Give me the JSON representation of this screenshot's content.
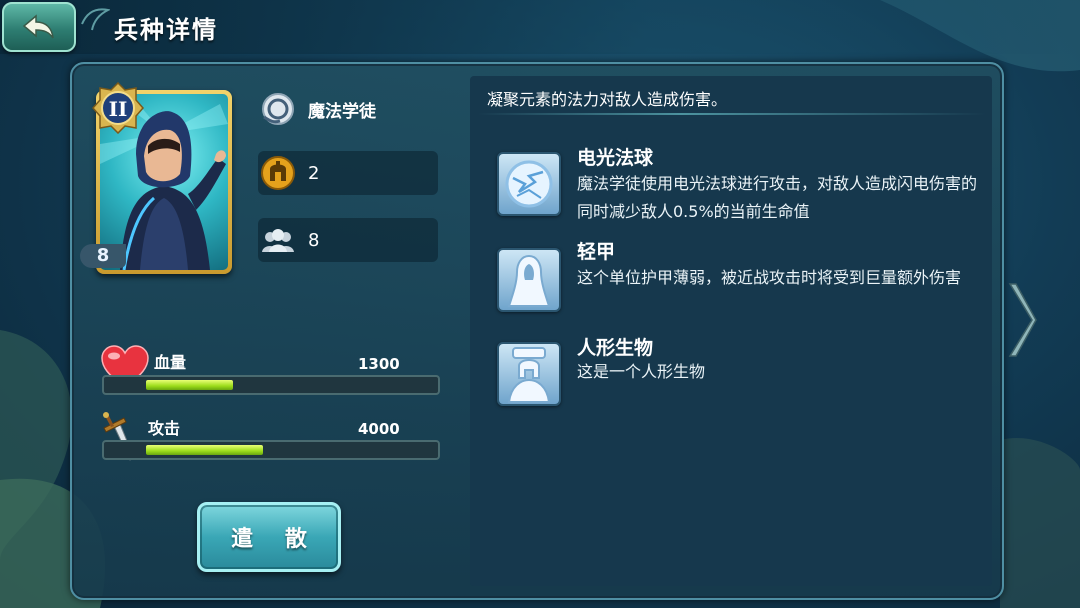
{
  "header": {
    "title": "兵种详情"
  },
  "unit": {
    "rank": "II",
    "level": "8",
    "name": "魔法学徒",
    "defense": "2",
    "population": "8",
    "icons": {
      "class": "magic-orb-icon",
      "defense": "spartan-helmet-icon",
      "population": "troops-icon"
    }
  },
  "stats": {
    "hp": {
      "label": "血量",
      "value": "1300",
      "fill": 0.29
    },
    "attack": {
      "label": "攻击",
      "value": "4000",
      "fill": 0.39
    }
  },
  "dismiss_label": "遣 散",
  "description": "凝聚元素的法力对敌人造成伤害。",
  "abilities": [
    {
      "title": "电光法球",
      "text": "魔法学徒使用电光法球进行攻击，对敌人造成闪电伤害的同时减少敌人0.5%的当前生命值",
      "icon": "lightning-orb-icon"
    },
    {
      "title": "轻甲",
      "text": "这个单位护甲薄弱，被近战攻击时将受到巨量额外伤害",
      "icon": "light-armor-icon"
    },
    {
      "title": "人形生物",
      "text": "这是一个人形生物",
      "icon": "humanoid-icon"
    }
  ],
  "colors": {
    "bar_green": "#9cdc1a",
    "card_gold": "#c99a2e",
    "button_teal": "#3aa7b6"
  }
}
